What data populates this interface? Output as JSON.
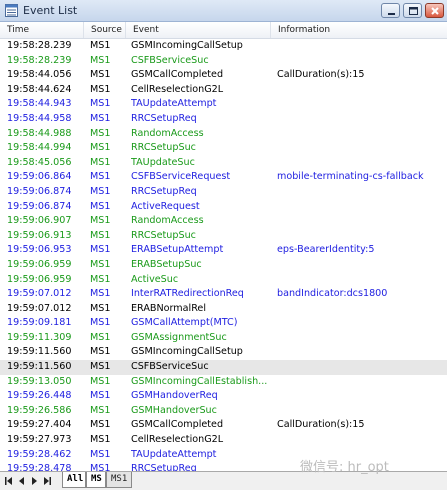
{
  "window": {
    "title": "Event List",
    "icon": "list-window-icon"
  },
  "columns": [
    "Time",
    "Source",
    "Event",
    "Information"
  ],
  "colors": {
    "black": "#000000",
    "green": "#1a9a1a",
    "blue": "#1e1ee0"
  },
  "rows": [
    {
      "time": "19:58:28.239",
      "source": "MS1",
      "event": "GSMIncomingCallSetup",
      "info": "",
      "color": "black"
    },
    {
      "time": "19:58:28.239",
      "source": "MS1",
      "event": "CSFBServiceSuc",
      "info": "",
      "color": "green"
    },
    {
      "time": "19:58:44.056",
      "source": "MS1",
      "event": "GSMCallCompleted",
      "info": "CallDuration(s):15",
      "color": "black"
    },
    {
      "time": "19:58:44.624",
      "source": "MS1",
      "event": "CellReselectionG2L",
      "info": "",
      "color": "black"
    },
    {
      "time": "19:58:44.943",
      "source": "MS1",
      "event": "TAUpdateAttempt",
      "info": "",
      "color": "blue"
    },
    {
      "time": "19:58:44.958",
      "source": "MS1",
      "event": "RRCSetupReq",
      "info": "",
      "color": "blue"
    },
    {
      "time": "19:58:44.988",
      "source": "MS1",
      "event": "RandomAccess",
      "info": "",
      "color": "green"
    },
    {
      "time": "19:58:44.994",
      "source": "MS1",
      "event": "RRCSetupSuc",
      "info": "",
      "color": "green"
    },
    {
      "time": "19:58:45.056",
      "source": "MS1",
      "event": "TAUpdateSuc",
      "info": "",
      "color": "green"
    },
    {
      "time": "19:59:06.864",
      "source": "MS1",
      "event": "CSFBServiceRequest",
      "info": "mobile-terminating-cs-fallback",
      "color": "blue"
    },
    {
      "time": "19:59:06.874",
      "source": "MS1",
      "event": "RRCSetupReq",
      "info": "",
      "color": "blue"
    },
    {
      "time": "19:59:06.874",
      "source": "MS1",
      "event": "ActiveRequest",
      "info": "",
      "color": "blue"
    },
    {
      "time": "19:59:06.907",
      "source": "MS1",
      "event": "RandomAccess",
      "info": "",
      "color": "green"
    },
    {
      "time": "19:59:06.913",
      "source": "MS1",
      "event": "RRCSetupSuc",
      "info": "",
      "color": "green"
    },
    {
      "time": "19:59:06.953",
      "source": "MS1",
      "event": "ERABSetupAttempt",
      "info": "eps-BearerIdentity:5",
      "color": "blue"
    },
    {
      "time": "19:59:06.959",
      "source": "MS1",
      "event": "ERABSetupSuc",
      "info": "",
      "color": "green"
    },
    {
      "time": "19:59:06.959",
      "source": "MS1",
      "event": "ActiveSuc",
      "info": "",
      "color": "green"
    },
    {
      "time": "19:59:07.012",
      "source": "MS1",
      "event": "InterRATRedirectionReq",
      "info": "bandIndicator:dcs1800",
      "color": "blue"
    },
    {
      "time": "19:59:07.012",
      "source": "MS1",
      "event": "ERABNormalRel",
      "info": "",
      "color": "black"
    },
    {
      "time": "19:59:09.181",
      "source": "MS1",
      "event": "GSMCallAttempt(MTC)",
      "info": "",
      "color": "blue"
    },
    {
      "time": "19:59:11.309",
      "source": "MS1",
      "event": "GSMAssignmentSuc",
      "info": "",
      "color": "green"
    },
    {
      "time": "19:59:11.560",
      "source": "MS1",
      "event": "GSMIncomingCallSetup",
      "info": "",
      "color": "black"
    },
    {
      "time": "19:59:11.560",
      "source": "MS1",
      "event": "CSFBServiceSuc",
      "info": "",
      "color": "black",
      "selected": true
    },
    {
      "time": "19:59:13.050",
      "source": "MS1",
      "event": "GSMIncomingCallEstablish...",
      "info": "",
      "color": "green"
    },
    {
      "time": "19:59:26.448",
      "source": "MS1",
      "event": "GSMHandoverReq",
      "info": "",
      "color": "blue"
    },
    {
      "time": "19:59:26.586",
      "source": "MS1",
      "event": "GSMHandoverSuc",
      "info": "",
      "color": "green"
    },
    {
      "time": "19:59:27.404",
      "source": "MS1",
      "event": "GSMCallCompleted",
      "info": "CallDuration(s):15",
      "color": "black"
    },
    {
      "time": "19:59:27.973",
      "source": "MS1",
      "event": "CellReselectionG2L",
      "info": "",
      "color": "black"
    },
    {
      "time": "19:59:28.462",
      "source": "MS1",
      "event": "TAUpdateAttempt",
      "info": "",
      "color": "blue"
    },
    {
      "time": "19:59:28.478",
      "source": "MS1",
      "event": "RRCSetupReq",
      "info": "",
      "color": "blue"
    }
  ],
  "bottom": {
    "nav_icons": [
      "first-icon",
      "prev-icon",
      "next-icon",
      "last-icon"
    ],
    "tabs": [
      "All",
      "MS",
      "MS1"
    ]
  },
  "watermark": "微信号: hr_opt"
}
